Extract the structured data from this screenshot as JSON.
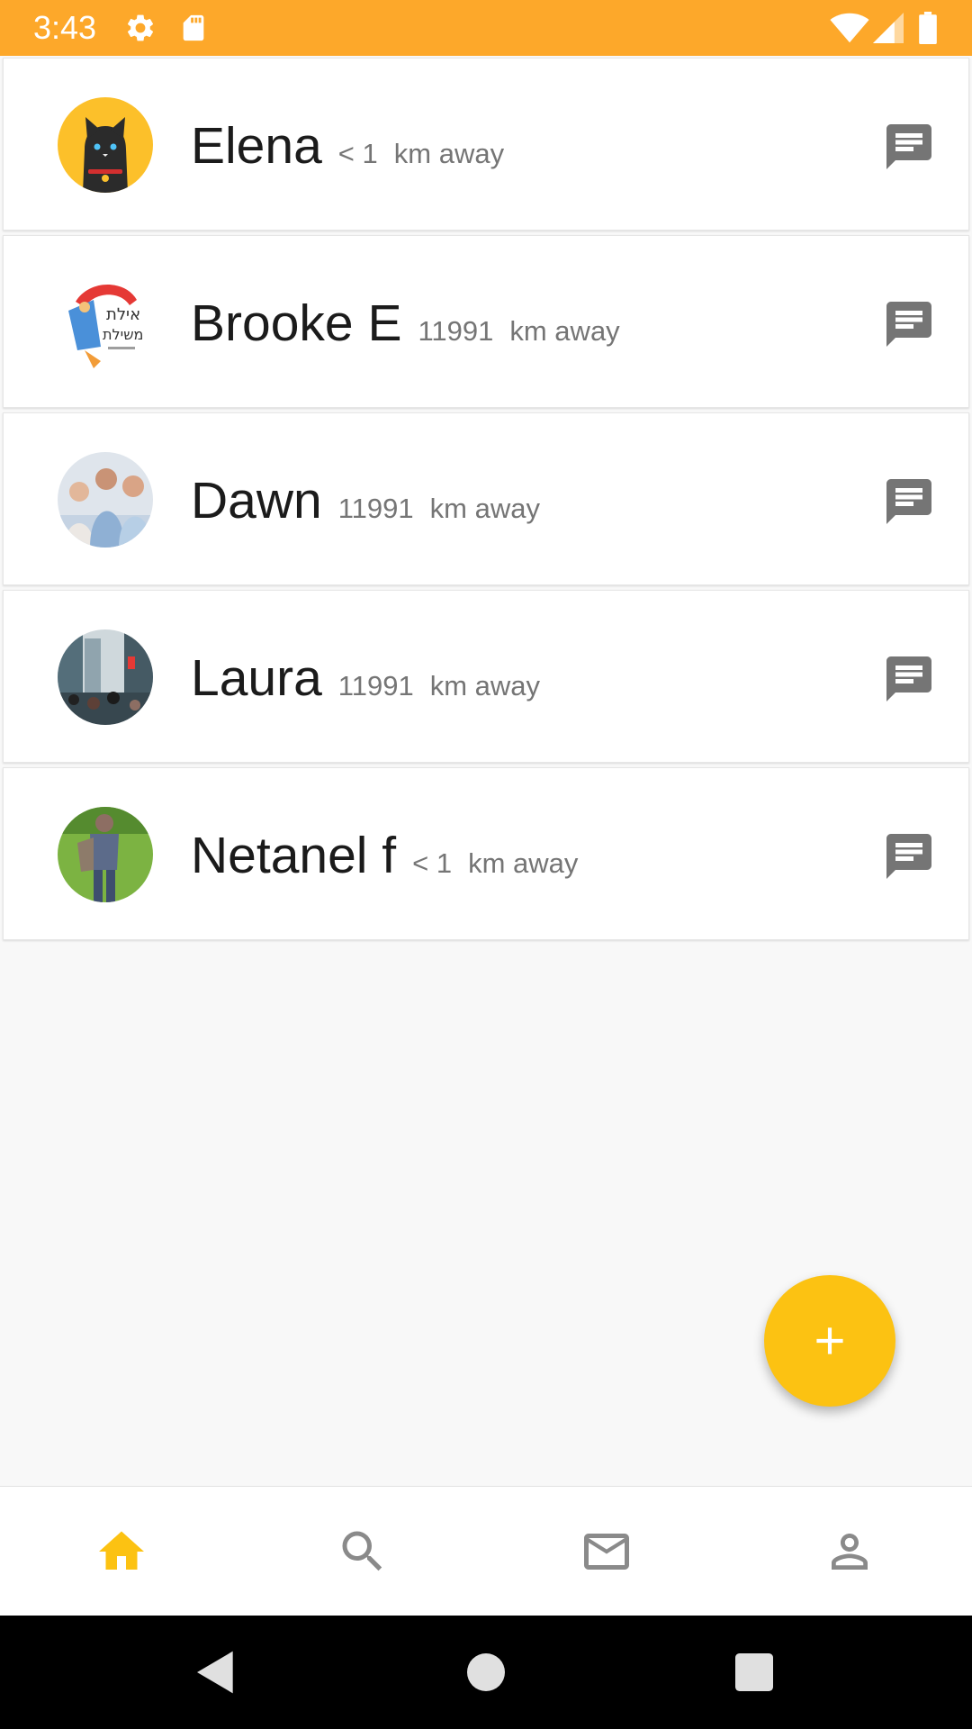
{
  "status_bar": {
    "time": "3:43",
    "background": "#fda82a",
    "icons": [
      "settings-icon",
      "sd-card-icon",
      "wifi-icon",
      "signal-icon",
      "battery-icon"
    ]
  },
  "contacts": [
    {
      "name": "Elena",
      "distance": "< 1",
      "unit": "km away",
      "avatar": "cat-avatar"
    },
    {
      "name": "Brooke E",
      "distance": "11991",
      "unit": "km away",
      "avatar": "illustration-avatar"
    },
    {
      "name": "Dawn",
      "distance": "11991",
      "unit": "km away",
      "avatar": "people-photo-avatar"
    },
    {
      "name": "Laura",
      "distance": "11991",
      "unit": "km away",
      "avatar": "city-photo-avatar"
    },
    {
      "name": "Netanel f",
      "distance": "< 1",
      "unit": "km away",
      "avatar": "park-photo-avatar"
    }
  ],
  "fab": {
    "icon": "plus-icon",
    "color": "#fcc212"
  },
  "bottom_nav": {
    "items": [
      "home-icon",
      "search-icon",
      "mail-icon",
      "person-icon"
    ],
    "active": "home",
    "active_color": "#fcc212",
    "inactive_color": "#8a8a8a"
  },
  "system_nav": [
    "back-icon",
    "home-circle-icon",
    "recents-icon"
  ]
}
